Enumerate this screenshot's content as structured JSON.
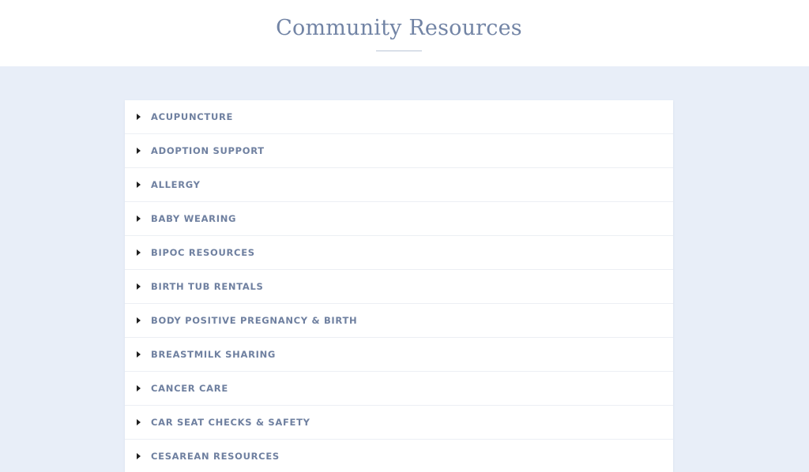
{
  "header": {
    "title": "Community Resources"
  },
  "accordion": {
    "items": [
      {
        "label": "ACUPUNCTURE",
        "icon": "caret-right-icon"
      },
      {
        "label": "ADOPTION SUPPORT",
        "icon": "caret-right-icon"
      },
      {
        "label": "ALLERGY",
        "icon": "caret-right-icon"
      },
      {
        "label": "BABY WEARING",
        "icon": "caret-right-icon"
      },
      {
        "label": "BIPOC RESOURCES",
        "icon": "caret-right-icon"
      },
      {
        "label": "BIRTH TUB RENTALS",
        "icon": "caret-right-icon"
      },
      {
        "label": "BODY POSITIVE PREGNANCY & BIRTH",
        "icon": "caret-right-icon"
      },
      {
        "label": "BREASTMILK SHARING",
        "icon": "caret-right-icon"
      },
      {
        "label": "CANCER CARE",
        "icon": "caret-right-icon"
      },
      {
        "label": "CAR SEAT CHECKS & SAFETY",
        "icon": "caret-right-icon"
      },
      {
        "label": "CESAREAN RESOURCES",
        "icon": "caret-right-icon"
      }
    ]
  },
  "colors": {
    "page_background": "#e8eef8",
    "title": "#7284a5",
    "item_label": "#6f80a0",
    "arrow": "#1f1f1f"
  }
}
